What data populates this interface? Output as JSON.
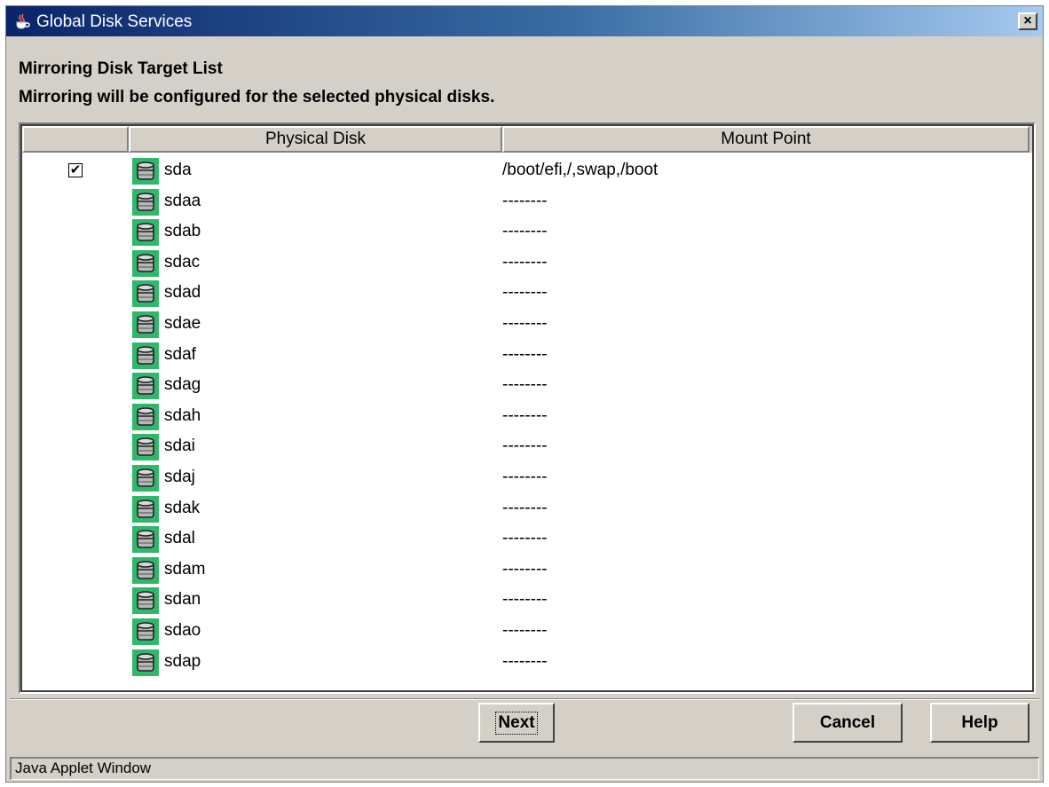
{
  "window": {
    "title": "Global Disk Services",
    "close_glyph": "×",
    "title_icon": "java-cup-icon",
    "titlebar_color": "#0a246a"
  },
  "header": {
    "title": "Mirroring Disk Target List",
    "description": "Mirroring will be configured for the selected physical disks."
  },
  "table": {
    "columns": [
      "",
      "Physical Disk",
      "Mount Point"
    ],
    "disk_icon": "disk-drive-icon",
    "rows": [
      {
        "checked": true,
        "check_glyph": "✔",
        "disk": "sda",
        "mount": "/boot/efi,/,swap,/boot"
      },
      {
        "checked": false,
        "check_glyph": "",
        "disk": "sdaa",
        "mount": "--------"
      },
      {
        "checked": false,
        "check_glyph": "",
        "disk": "sdab",
        "mount": "--------"
      },
      {
        "checked": false,
        "check_glyph": "",
        "disk": "sdac",
        "mount": "--------"
      },
      {
        "checked": false,
        "check_glyph": "",
        "disk": "sdad",
        "mount": "--------"
      },
      {
        "checked": false,
        "check_glyph": "",
        "disk": "sdae",
        "mount": "--------"
      },
      {
        "checked": false,
        "check_glyph": "",
        "disk": "sdaf",
        "mount": "--------"
      },
      {
        "checked": false,
        "check_glyph": "",
        "disk": "sdag",
        "mount": "--------"
      },
      {
        "checked": false,
        "check_glyph": "",
        "disk": "sdah",
        "mount": "--------"
      },
      {
        "checked": false,
        "check_glyph": "",
        "disk": "sdai",
        "mount": "--------"
      },
      {
        "checked": false,
        "check_glyph": "",
        "disk": "sdaj",
        "mount": "--------"
      },
      {
        "checked": false,
        "check_glyph": "",
        "disk": "sdak",
        "mount": "--------"
      },
      {
        "checked": false,
        "check_glyph": "",
        "disk": "sdal",
        "mount": "--------"
      },
      {
        "checked": false,
        "check_glyph": "",
        "disk": "sdam",
        "mount": "--------"
      },
      {
        "checked": false,
        "check_glyph": "",
        "disk": "sdan",
        "mount": "--------"
      },
      {
        "checked": false,
        "check_glyph": "",
        "disk": "sdao",
        "mount": "--------"
      },
      {
        "checked": false,
        "check_glyph": "",
        "disk": "sdap",
        "mount": "--------"
      }
    ]
  },
  "buttons": {
    "next": "Next",
    "cancel": "Cancel",
    "help": "Help"
  },
  "status": "Java Applet Window",
  "colors": {
    "window_bg": "#d4d0c8",
    "disk_icon_bg": "#2fb86a",
    "disk_icon_body": "#b8b8b8"
  }
}
